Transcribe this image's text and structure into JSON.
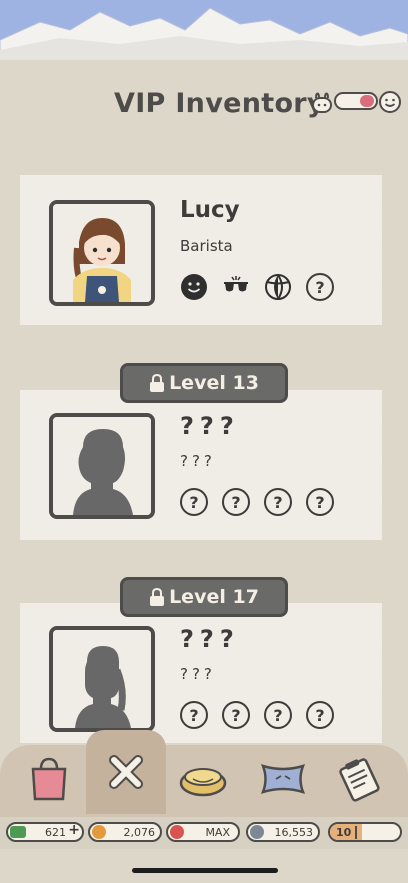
{
  "header": {
    "title": "VIP Inventory",
    "toggle": {
      "state": "on",
      "accent": "#d96d7c"
    }
  },
  "characters": [
    {
      "name": "Lucy",
      "role": "Barista",
      "level_badge": "",
      "unlocked": true,
      "icons": [
        "smiley-icon",
        "sunglasses-icon",
        "beach-ball-icon",
        "question-icon"
      ],
      "unknown_icon_text": "?"
    },
    {
      "name": "???",
      "role": "???",
      "level_badge": "Level 13",
      "unlocked": false,
      "icons": [
        "question-icon",
        "question-icon",
        "question-icon",
        "question-icon"
      ],
      "unknown_icon_text": "?"
    },
    {
      "name": "???",
      "role": "???",
      "level_badge": "Level 17",
      "unlocked": false,
      "icons": [
        "question-icon",
        "question-icon",
        "question-icon",
        "question-icon"
      ],
      "unknown_icon_text": "?"
    }
  ],
  "nav": {
    "items": [
      "shopping-bag-icon",
      "close-icon",
      "cushion-icon",
      "pillow-icon",
      "clipboard-icon"
    ],
    "selected": "close-icon"
  },
  "currencies": {
    "cash": {
      "value": "621",
      "plus": "+",
      "color": "#4e9a52"
    },
    "coins": {
      "value": "2,076",
      "color": "#e29b3c"
    },
    "hearts": {
      "value": "MAX",
      "color": "#d9534f"
    },
    "gems": {
      "value": "16,553",
      "color": "#7c8896"
    },
    "level": {
      "value": "10",
      "progress": 0.45,
      "color": "#e6b07a"
    }
  }
}
